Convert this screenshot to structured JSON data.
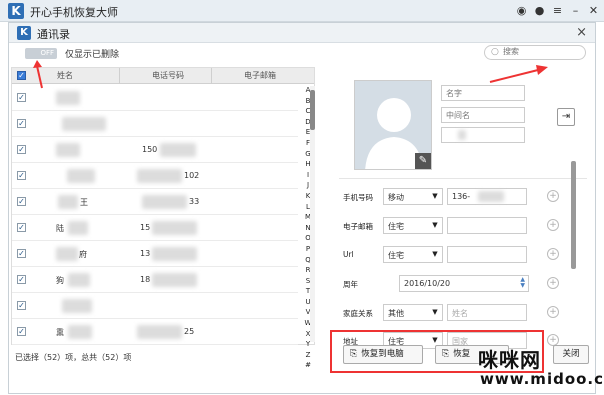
{
  "app": {
    "title": "开心手机恢复大师",
    "logo_letter": "K"
  },
  "dialog": {
    "title": "通讯录",
    "logo_letter": "K"
  },
  "toolbar": {
    "toggle_text": "OFF",
    "toggle_label": "仅显示已删除",
    "search_placeholder": "搜索"
  },
  "table": {
    "headers": [
      "姓名",
      "电话号码",
      "电子邮箱"
    ],
    "rows": [
      {
        "name": "",
        "phone": ""
      },
      {
        "name": "",
        "phone": ""
      },
      {
        "name": "",
        "phone": "150"
      },
      {
        "name": "",
        "phone": "102"
      },
      {
        "name": "王",
        "phone": "33"
      },
      {
        "name": "陆",
        "phone": "15"
      },
      {
        "name": "府",
        "phone": "13"
      },
      {
        "name": "狗",
        "phone": "18"
      },
      {
        "name": "",
        "phone": ""
      },
      {
        "name": "熏",
        "phone": "25"
      }
    ],
    "alphabet": [
      "A",
      "B",
      "C",
      "D",
      "E",
      "F",
      "G",
      "H",
      "I",
      "J",
      "K",
      "L",
      "M",
      "N",
      "O",
      "P",
      "Q",
      "R",
      "S",
      "T",
      "U",
      "V",
      "W",
      "X",
      "Y",
      "Z",
      "#"
    ]
  },
  "status": "已选择（52）项，总共（52）项",
  "detail": {
    "name_placeholder": "名字",
    "middle_placeholder": "中间名",
    "rows": [
      {
        "label": "手机号码",
        "type": "移动",
        "value": "136-",
        "placeholder": ""
      },
      {
        "label": "电子邮箱",
        "type": "住宅",
        "value": "",
        "placeholder": ""
      },
      {
        "label": "Url",
        "type": "住宅",
        "value": "",
        "placeholder": ""
      },
      {
        "label": "周年",
        "date": "2016/10/20"
      },
      {
        "label": "家庭关系",
        "type": "其他",
        "value": "",
        "placeholder": "姓名"
      },
      {
        "label": "地址",
        "type": "住宅",
        "value": "",
        "placeholder": "国家"
      }
    ]
  },
  "buttons": {
    "restore": "恢复到电脑",
    "restore2": "恢复",
    "close": "关闭"
  },
  "watermark": {
    "cn": "咪咪网",
    "url": "www.midoo.cc"
  },
  "colors": {
    "accent": "#2f6fb5",
    "highlight": "#ee3333"
  }
}
